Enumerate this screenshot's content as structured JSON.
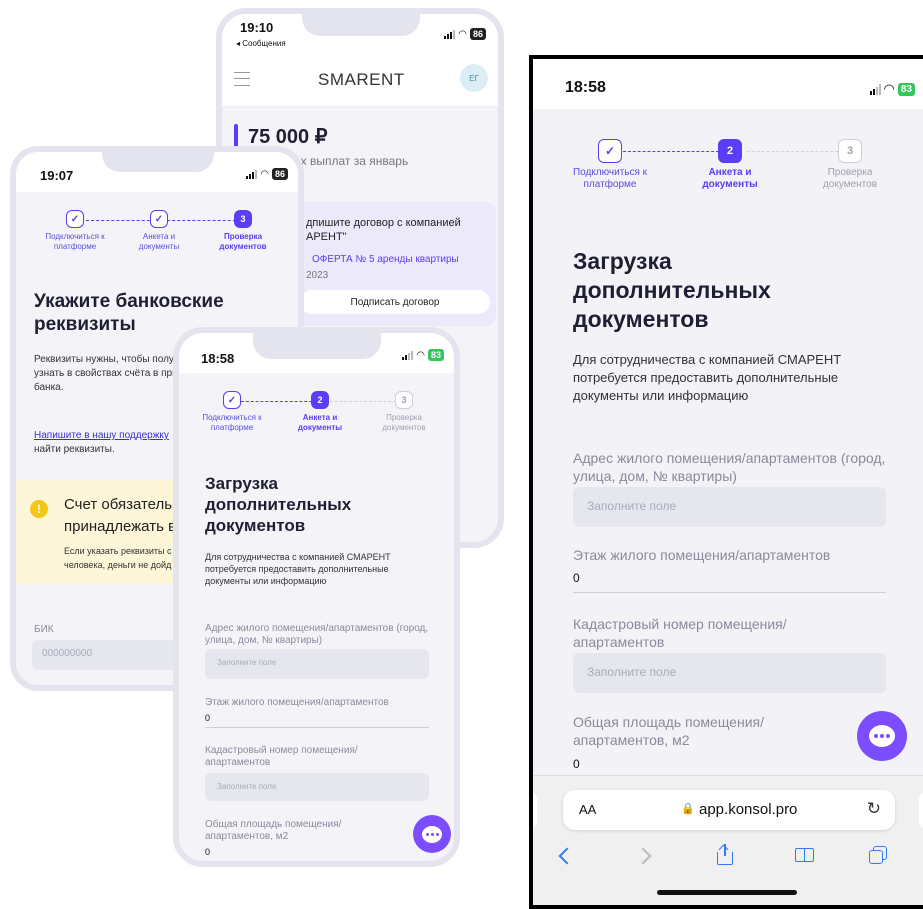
{
  "colors": {
    "accent": "#5b3df5",
    "fab": "#7b4dff",
    "warning_bg": "#fdf6d8",
    "warning_icon": "#f5c518",
    "offer_bg": "#ece9fb"
  },
  "stepper": {
    "step1": "Подключиться к платформе",
    "step2": "Анкета и документы",
    "step3": "Проверка документов",
    "check": "✓",
    "num2": "2",
    "num3": "3"
  },
  "back_phone": {
    "time": "19:10",
    "back_link": "◂ Сообщения",
    "battery": "86",
    "brand": "SMARENT",
    "avatar": "ЕГ",
    "amount": "75 000 ₽",
    "amount_caption": "всех выплат за январь",
    "offer_title": "дпишите договор с компанией АРЕНТ\"",
    "offer_link": "ОФЕРТА № 5 аренды квартиры",
    "offer_year": "2023",
    "sign_button": "Подписать договор"
  },
  "bank_phone": {
    "time": "19:07",
    "battery": "86",
    "title": "Укажите банковские реквизиты",
    "text_line1": "Реквизиты нужны, чтобы полу",
    "text_line2": "узнать в свойствах счёта в при",
    "text_line3": "банка.",
    "support_link": "Напишите в нашу поддержку",
    "support_tail": ", ",
    "support_line2": "найти реквизиты.",
    "warning_title_l1": "Счет обязательно",
    "warning_title_l2": "принадлежать ва",
    "warning_text_l1": "Если указать реквизиты с",
    "warning_text_l2": "человека, деньги не дойд",
    "bik_label": "БИК",
    "bik_placeholder": "000000000"
  },
  "upload_form": {
    "time": "18:58",
    "battery": "83",
    "title": "Загрузка дополнительных документов",
    "description": "Для сотрудничества с компанией СМАРЕНТ потребуется предоставить дополнительные документы или информацию",
    "address_label": "Адрес жилого помещения/апартаментов (город, улица, дом, № квартиры)",
    "placeholder": "Заполните поле",
    "floor_label": "Этаж жилого помещения/апартаментов",
    "floor_value": "0",
    "cadastral_label": "Кадастровый номер помещения/ апартаментов",
    "area_label": "Общая площадь помещения/ апартаментов, м2",
    "area_value": "0"
  },
  "safari": {
    "text_size": "AA",
    "url": "app.konsol.pro",
    "lock": "🔒",
    "reload": "↻"
  }
}
